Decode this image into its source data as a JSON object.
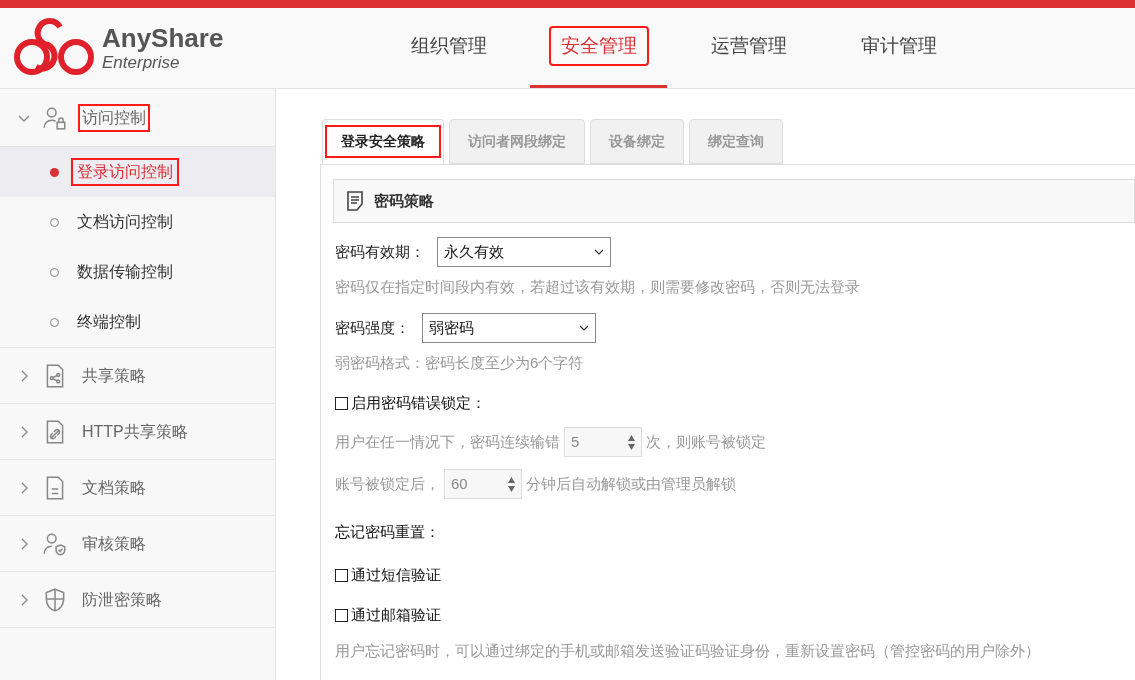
{
  "header": {
    "logo": {
      "name": "AnyShare",
      "subtitle": "Enterprise"
    },
    "nav": [
      {
        "label": "组织管理",
        "selected": false,
        "highlighted": false
      },
      {
        "label": "安全管理",
        "selected": true,
        "highlighted": true
      },
      {
        "label": "运营管理",
        "selected": false,
        "highlighted": false
      },
      {
        "label": "审计管理",
        "selected": false,
        "highlighted": false
      }
    ]
  },
  "sidebar": {
    "groups": [
      {
        "label": "访问控制",
        "kind": "user-lock",
        "expanded": true,
        "highlighted": true,
        "children": [
          {
            "label": "登录访问控制",
            "selected": true,
            "highlighted": true
          },
          {
            "label": "文档访问控制",
            "selected": false,
            "highlighted": false
          },
          {
            "label": "数据传输控制",
            "selected": false,
            "highlighted": false
          },
          {
            "label": "终端控制",
            "selected": false,
            "highlighted": false
          }
        ]
      },
      {
        "label": "共享策略",
        "kind": "share-doc",
        "expanded": false,
        "highlighted": false
      },
      {
        "label": "HTTP共享策略",
        "kind": "link-doc",
        "expanded": false,
        "highlighted": false
      },
      {
        "label": "文档策略",
        "kind": "doc",
        "expanded": false,
        "highlighted": false
      },
      {
        "label": "审核策略",
        "kind": "user-shield",
        "expanded": false,
        "highlighted": false
      },
      {
        "label": "防泄密策略",
        "kind": "shield",
        "expanded": false,
        "highlighted": false
      }
    ]
  },
  "content": {
    "tabs": [
      {
        "label": "登录安全策略",
        "selected": true,
        "highlighted": true
      },
      {
        "label": "访问者网段绑定",
        "selected": false,
        "highlighted": false
      },
      {
        "label": "设备绑定",
        "selected": false,
        "highlighted": false
      },
      {
        "label": "绑定查询",
        "selected": false,
        "highlighted": false
      }
    ],
    "section": {
      "title": "密码策略"
    },
    "rows": [
      {
        "kind": "select",
        "label": "密码有效期：",
        "value": "永久有效"
      },
      {
        "kind": "hint",
        "text": "密码仅在指定时间段内有效，若超过该有效期，则需要修改密码，否则无法登录"
      },
      {
        "kind": "select",
        "label": "密码强度：",
        "value": "弱密码"
      },
      {
        "kind": "hint",
        "text": "弱密码格式：密码长度至少为6个字符"
      },
      {
        "kind": "checkbox",
        "label": "启用密码错误锁定：",
        "checked": false
      },
      {
        "kind": "spinner",
        "prefix": "用户在任一情况下，密码连续输错",
        "value": "5",
        "suffix": "次，则账号被锁定",
        "disabled": true
      },
      {
        "kind": "spinner",
        "prefix": "账号被锁定后，",
        "value": "60",
        "suffix": "分钟后自动解锁或由管理员解锁",
        "disabled": true
      },
      {
        "kind": "heading",
        "text": "忘记密码重置："
      },
      {
        "kind": "checkbox",
        "label": "通过短信验证",
        "checked": false
      },
      {
        "kind": "checkbox",
        "label": "通过邮箱验证",
        "checked": false
      },
      {
        "kind": "hint",
        "text": "用户忘记密码时，可以通过绑定的手机或邮箱发送验证码验证身份，重新设置密码（管控密码的用户除外）"
      }
    ]
  }
}
